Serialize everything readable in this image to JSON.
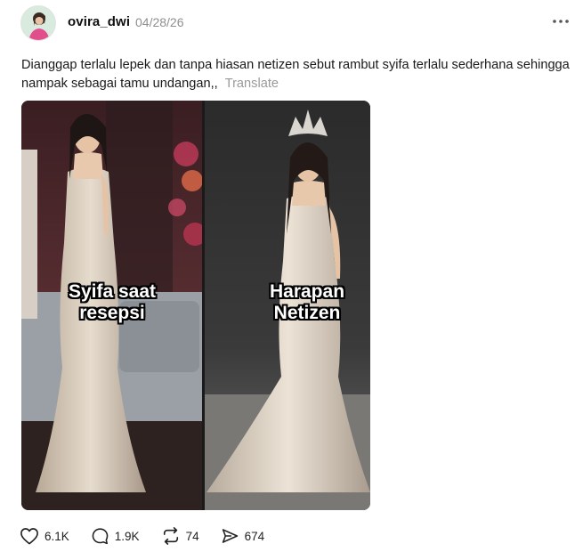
{
  "post": {
    "username": "ovira_dwi",
    "date": "04/28/26",
    "caption": "Dianggap terlalu lepek dan tanpa hiasan netizen sebut rambut syifa terlalu sederhana sehingga nampak sebagai tamu undangan,,",
    "translate_label": "Translate",
    "image": {
      "left_label": "Syifa saat\nresepsi",
      "right_label": "Harapan\nNetizen"
    },
    "actions": {
      "likes": "6.1K",
      "comments": "1.9K",
      "reposts": "74",
      "shares": "674"
    }
  },
  "icons": {
    "more": "more-horizontal-icon",
    "like": "heart-icon",
    "comment": "comment-bubble-icon",
    "repost": "repost-icon",
    "share": "send-icon"
  }
}
